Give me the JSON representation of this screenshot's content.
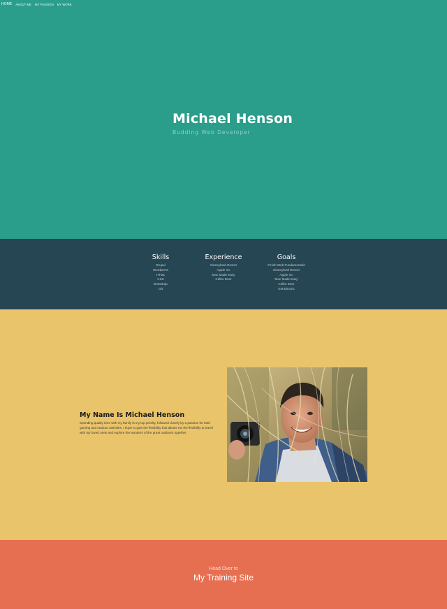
{
  "nav": {
    "items": [
      {
        "label": "HOME",
        "active": true
      },
      {
        "label": "ABOUT ME",
        "active": false
      },
      {
        "label": "MY PASSION",
        "active": false
      },
      {
        "label": "MY WORK",
        "active": false
      }
    ]
  },
  "hero": {
    "name": "Michael Henson",
    "tagline": "Budding Web Developer"
  },
  "info": {
    "skills": {
      "title": "Skills",
      "items": [
        "Drupal",
        "Wordpress",
        "HTML",
        "CSS",
        "Bootstrap",
        "Git"
      ]
    },
    "experience": {
      "title": "Experience",
      "items": [
        "Disneyland Resort",
        "Apple Inc",
        "Mac Made Easy",
        "Cellar Door"
      ]
    },
    "goals": {
      "title": "Goals",
      "items": [
        "Finish Web Fundamentals",
        "Disneyland Resort",
        "Apple Inc",
        "Mac Made Easy",
        "Cellar Door",
        "GM Electric"
      ]
    }
  },
  "about": {
    "title": "My Name Is Michael Henson",
    "text": "Spending quality time with my family is my top priority, followed closely by a passion for both gaming and outdoor activities. I hope to gain the flexibility that allows me the flexibility to travel with my loved ones and explore the wonders of the great outdoors together.",
    "photo": "portrait-photo"
  },
  "footer": {
    "line1": "Head Over to",
    "line2": "My Training Site"
  },
  "colors": {
    "hero": "#2b9d8b",
    "info": "#264653",
    "about": "#e9c46a",
    "footer": "#e76f51"
  }
}
